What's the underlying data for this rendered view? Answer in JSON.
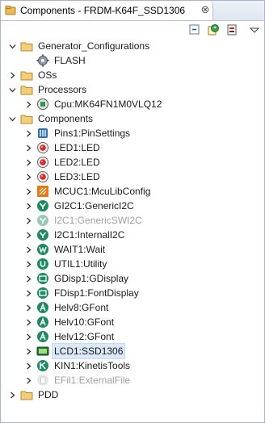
{
  "view": {
    "title": "Components - FRDM-K64F_SSD1306",
    "close_label": "⊗"
  },
  "toolbar": {
    "buttons": [
      "collapse-all-icon",
      "refresh-icon",
      "generate-code-icon",
      "view-menu-icon"
    ]
  },
  "tree": {
    "generator_configurations": {
      "label": "Generator_Configurations",
      "children": [
        {
          "label": "FLASH"
        }
      ]
    },
    "oss": {
      "label": "OSs"
    },
    "processors": {
      "label": "Processors",
      "children": [
        {
          "label": "Cpu:MK64FN1M0VLQ12"
        }
      ]
    },
    "components": {
      "label": "Components",
      "children": [
        {
          "label": "Pins1:PinSettings",
          "icon": "pins-icon"
        },
        {
          "label": "LED1:LED",
          "icon": "led-icon"
        },
        {
          "label": "LED2:LED",
          "icon": "led-icon"
        },
        {
          "label": "LED3:LED",
          "icon": "led-icon"
        },
        {
          "label": "MCUC1:McuLibConfig",
          "icon": "mcu-lib-config-icon"
        },
        {
          "label": "GI2C1:GenericI2C",
          "icon": "i2c-icon"
        },
        {
          "label": "I2C1:GenericSWI2C",
          "icon": "i2c-icon",
          "disabled": true
        },
        {
          "label": "I2C1:InternalI2C",
          "icon": "i2c-icon"
        },
        {
          "label": "WAIT1:Wait",
          "icon": "wait-icon"
        },
        {
          "label": "UTIL1:Utility",
          "icon": "utility-icon"
        },
        {
          "label": "GDisp1:GDisplay",
          "icon": "display-icon"
        },
        {
          "label": "FDisp1:FontDisplay",
          "icon": "display-icon"
        },
        {
          "label": "Helv8:GFont",
          "icon": "font-icon"
        },
        {
          "label": "Helv10:GFont",
          "icon": "font-icon"
        },
        {
          "label": "Helv12:GFont",
          "icon": "font-icon"
        },
        {
          "label": "LCD1:SSD1306",
          "icon": "lcd-icon",
          "selected": true
        },
        {
          "label": "KIN1:KinetisTools",
          "icon": "kinetis-icon"
        },
        {
          "label": "EFil1:ExternalFile",
          "icon": "file-icon",
          "disabled": true
        }
      ]
    },
    "pdd": {
      "label": "PDD"
    }
  },
  "colors": {
    "folder": "#e9b95a",
    "selection": "#dbe8f8",
    "disabled_text": "#a0a0a0",
    "component_green": "#1f8a62",
    "led_red": "#d12a2a"
  }
}
